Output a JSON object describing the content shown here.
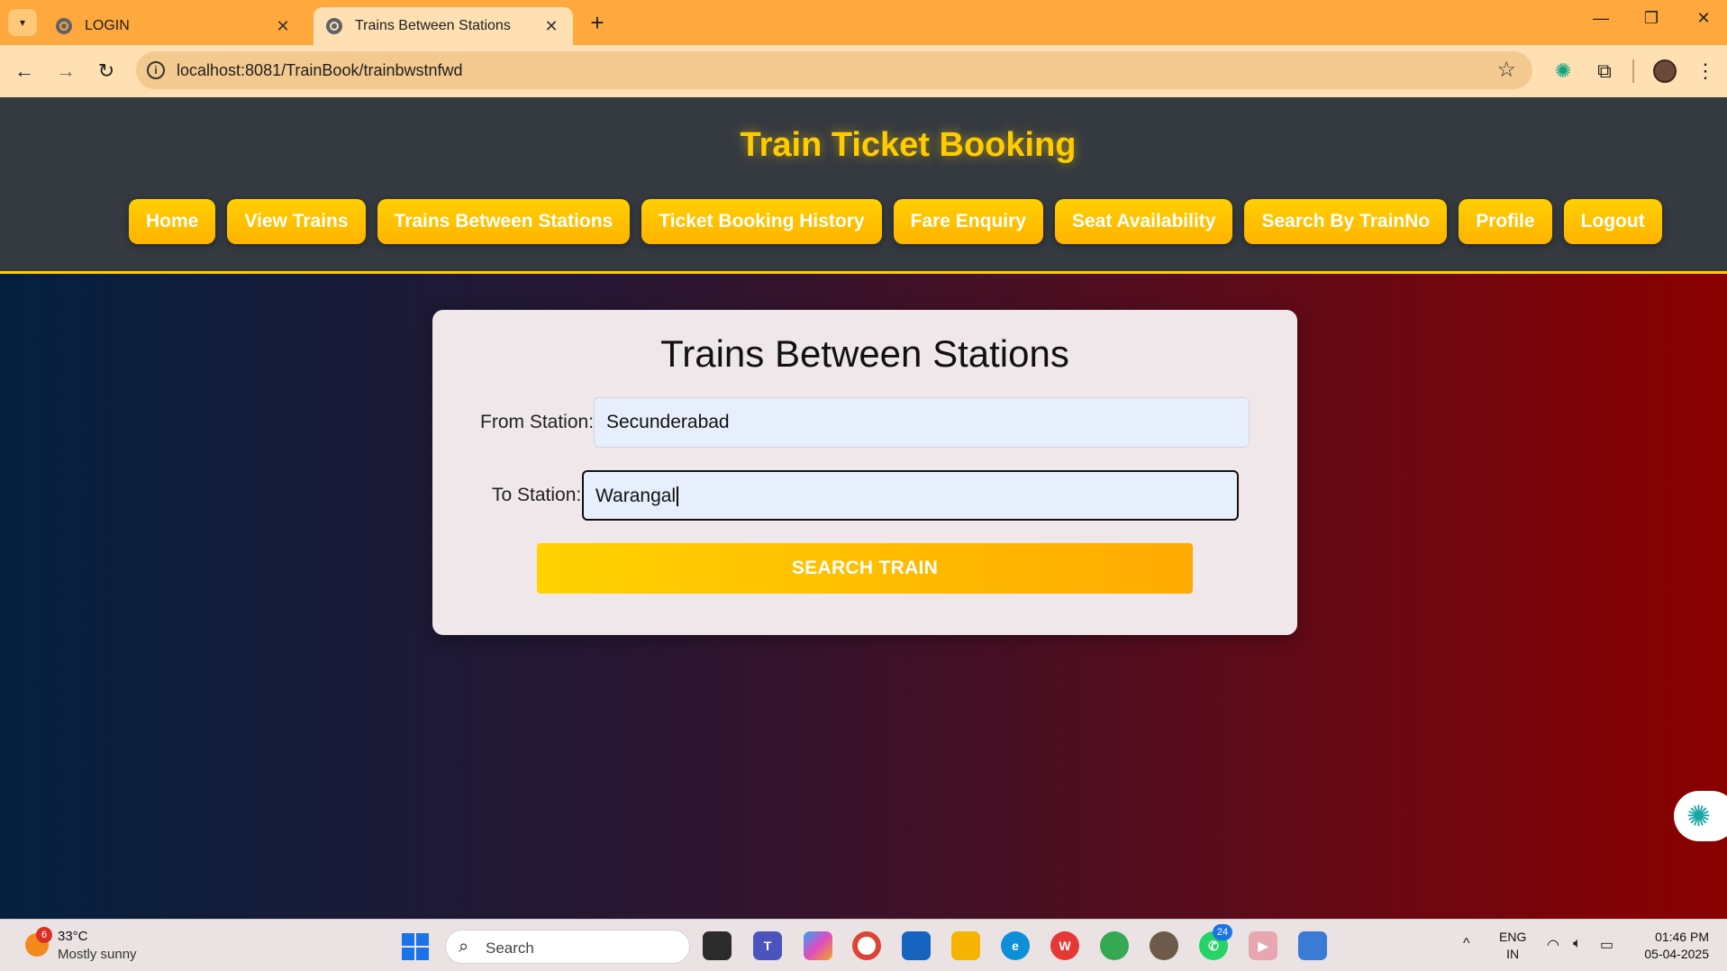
{
  "browser": {
    "tabs": [
      {
        "title": "LOGIN",
        "active": false
      },
      {
        "title": "Trains Between Stations",
        "active": true
      }
    ],
    "url": "localhost:8081/TrainBook/trainbwstnfwd"
  },
  "site": {
    "title": "Train Ticket Booking",
    "nav": [
      "Home",
      "View Trains",
      "Trains Between Stations",
      "Ticket Booking History",
      "Fare Enquiry",
      "Seat Availability",
      "Search By TrainNo",
      "Profile",
      "Logout"
    ]
  },
  "form": {
    "title": "Trains Between Stations",
    "from_label": "From Station:",
    "from_value": "Secunderabad",
    "to_label": "To Station:",
    "to_value": "Warangal",
    "submit_label": "SEARCH TRAIN"
  },
  "colors": {
    "header_bg": "#343a40",
    "accent": "#ffcc00",
    "button_gradient_start": "#ffd200",
    "button_gradient_end": "#ffaa00"
  },
  "taskbar": {
    "weather_badge": "6",
    "weather_temp": "33°C",
    "weather_condition": "Mostly sunny",
    "search_placeholder": "Search",
    "whatsapp_badge": "24",
    "lang_line1": "ENG",
    "lang_line2": "IN",
    "time": "01:46 PM",
    "date": "05-04-2025"
  }
}
